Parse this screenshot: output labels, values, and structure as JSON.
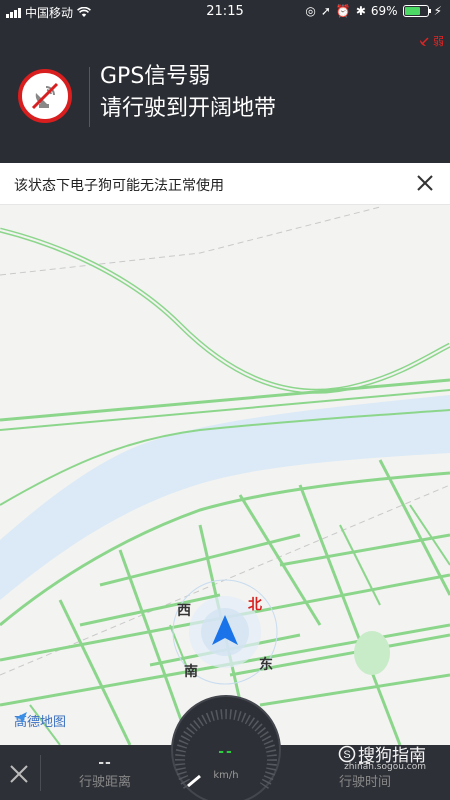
{
  "status_bar": {
    "carrier": "中国移动",
    "time": "21:15",
    "battery": "69%",
    "battery_level": 0.69
  },
  "gps_indicator_label": "弱",
  "header": {
    "title": "GPS信号弱",
    "subtitle": "请行驶到开阔地带",
    "icon": "satellite-dish-icon",
    "accent_color": "#d81e1e"
  },
  "notice": {
    "text": "该状态下电子狗可能无法正常使用"
  },
  "compass": {
    "north": "北",
    "south": "南",
    "east": "东",
    "west": "西"
  },
  "map_logo": "高德地图",
  "bottom_bar": {
    "distance_value": "--",
    "distance_label": "行驶距离",
    "speed_value": "--",
    "speed_unit": "km/h",
    "time_value": "--",
    "time_label": "行驶时间",
    "speed_color": "#2ecc40"
  },
  "watermark": {
    "title": "搜狗指南",
    "url": "zhinan.sogou.com"
  }
}
